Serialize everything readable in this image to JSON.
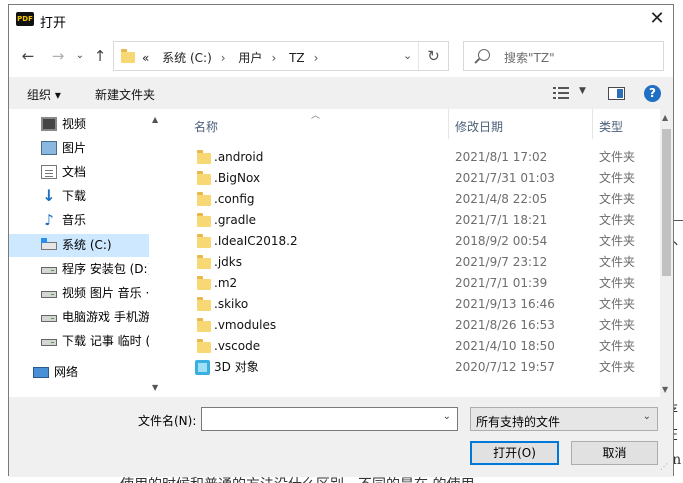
{
  "window": {
    "title": "打开",
    "app_icon_text": "PDF"
  },
  "nav": {
    "breadcrumb": [
      "«",
      "系统 (C:)",
      "用户",
      "TZ"
    ],
    "search_placeholder": "搜索\"TZ\""
  },
  "toolbar": {
    "organize": "组织 ▾",
    "new_folder": "新建文件夹"
  },
  "sidebar": {
    "items": [
      {
        "label": "视频",
        "icon": "video-folder-icon"
      },
      {
        "label": "图片",
        "icon": "pictures-folder-icon"
      },
      {
        "label": "文档",
        "icon": "documents-folder-icon"
      },
      {
        "label": "下载",
        "icon": "download-arrow-icon"
      },
      {
        "label": "音乐",
        "icon": "music-note-icon"
      },
      {
        "label": "系统 (C:)",
        "icon": "system-drive-icon",
        "selected": true
      },
      {
        "label": "程序 安装包 (D:)",
        "icon": "drive-icon"
      },
      {
        "label": "视频 图片 音乐 ·",
        "icon": "drive-icon"
      },
      {
        "label": "电脑游戏 手机游",
        "icon": "drive-icon"
      },
      {
        "label": "下载 记事 临时 (",
        "icon": "drive-icon"
      },
      {
        "label": "网络",
        "icon": "network-icon"
      }
    ]
  },
  "columns": {
    "name": "名称",
    "date": "修改日期",
    "type": "类型"
  },
  "files": [
    {
      "name": ".android",
      "date": "2021/8/1 17:02",
      "type": "文件夹",
      "icon": "folder-icon"
    },
    {
      "name": ".BigNox",
      "date": "2021/7/31 01:03",
      "type": "文件夹",
      "icon": "folder-icon"
    },
    {
      "name": ".config",
      "date": "2021/4/8 22:05",
      "type": "文件夹",
      "icon": "folder-icon"
    },
    {
      "name": ".gradle",
      "date": "2021/7/1 18:21",
      "type": "文件夹",
      "icon": "folder-icon"
    },
    {
      "name": ".IdeaIC2018.2",
      "date": "2018/9/2 00:54",
      "type": "文件夹",
      "icon": "folder-icon"
    },
    {
      "name": ".jdks",
      "date": "2021/9/7 23:12",
      "type": "文件夹",
      "icon": "folder-icon"
    },
    {
      "name": ".m2",
      "date": "2021/7/1 01:39",
      "type": "文件夹",
      "icon": "folder-icon"
    },
    {
      "name": ".skiko",
      "date": "2021/9/13 16:46",
      "type": "文件夹",
      "icon": "folder-icon"
    },
    {
      "name": ".vmodules",
      "date": "2021/8/26 16:53",
      "type": "文件夹",
      "icon": "folder-icon"
    },
    {
      "name": ".vscode",
      "date": "2021/4/10 18:50",
      "type": "文件夹",
      "icon": "folder-icon"
    },
    {
      "name": "3D 对象",
      "date": "2020/7/12 19:57",
      "type": "文件夹",
      "icon": "3d-objects-icon"
    }
  ],
  "bottom": {
    "filename_label": "文件名(N):",
    "filename_value": "",
    "filter_value": "所有支持的文件",
    "open_button": "打开(O)",
    "cancel_button": "取消"
  },
  "background_doc": {
    "chars": [
      "外",
      "存",
      "在",
      "en"
    ],
    "bottom_line": "使用的时候和普通的方法没什么区别。不同的是在    的使用"
  }
}
